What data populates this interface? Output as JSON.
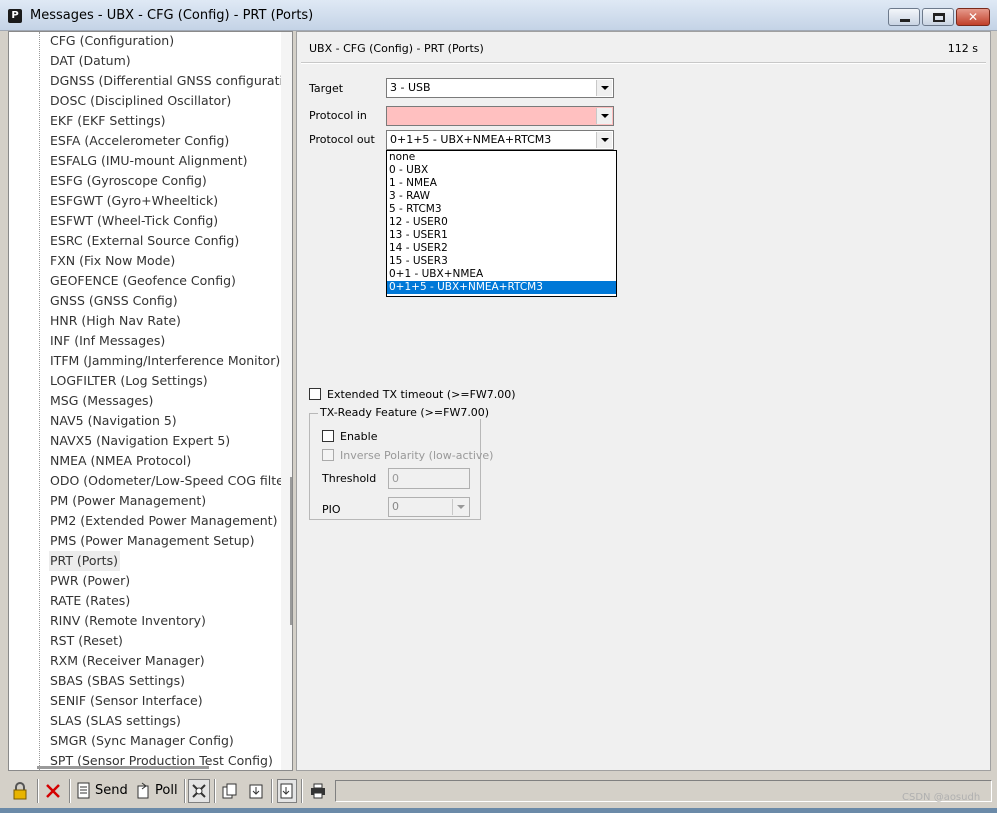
{
  "window": {
    "icon_letter": "P",
    "title": "Messages - UBX - CFG (Config) - PRT (Ports)",
    "close_glyph": "✕"
  },
  "tree": {
    "items": [
      "CFG (Configuration)",
      "DAT (Datum)",
      "DGNSS (Differential GNSS configuration)",
      "DOSC (Disciplined Oscillator)",
      "EKF (EKF Settings)",
      "ESFA (Accelerometer Config)",
      "ESFALG (IMU-mount Alignment)",
      "ESFG (Gyroscope Config)",
      "ESFGWT (Gyro+Wheeltick)",
      "ESFWT (Wheel-Tick Config)",
      "ESRC (External Source Config)",
      "FXN (Fix Now Mode)",
      "GEOFENCE (Geofence Config)",
      "GNSS (GNSS Config)",
      "HNR (High Nav Rate)",
      "INF (Inf Messages)",
      "ITFM (Jamming/Interference Monitor)",
      "LOGFILTER (Log Settings)",
      "MSG (Messages)",
      "NAV5 (Navigation 5)",
      "NAVX5 (Navigation Expert 5)",
      "NMEA (NMEA Protocol)",
      "ODO (Odometer/Low-Speed COG filter)",
      "PM (Power Management)",
      "PM2 (Extended Power Management)",
      "PMS (Power Management Setup)",
      "PRT (Ports)",
      "PWR (Power)",
      "RATE (Rates)",
      "RINV (Remote Inventory)",
      "RST (Reset)",
      "RXM (Receiver Manager)",
      "SBAS (SBAS Settings)",
      "SENIF (Sensor Interface)",
      "SLAS (SLAS settings)",
      "SMGR (Sync Manager Config)",
      "SPT (Sensor Production Test Config)"
    ],
    "selected_index": 26
  },
  "panel": {
    "title": "UBX - CFG (Config) - PRT (Ports)",
    "timer": "112 s",
    "target_label": "Target",
    "target_value": "3 - USB",
    "protocol_in_label": "Protocol in",
    "protocol_in_value": "",
    "protocol_out_label": "Protocol out",
    "protocol_out_value": "0+1+5 - UBX+NMEA+RTCM3",
    "protocol_out_options": [
      "none",
      "0 - UBX",
      "1 - NMEA",
      "3 - RAW",
      "5 - RTCM3",
      "12 - USER0",
      "13 - USER1",
      "14 - USER2",
      "15 - USER3",
      "0+1 - UBX+NMEA",
      "0+1+5 - UBX+NMEA+RTCM3"
    ],
    "protocol_out_selected_index": 10,
    "extended_tx_label": "Extended TX timeout (>=FW7.00)",
    "txready_title": "TX-Ready Feature (>=FW7.00)",
    "enable_label": "Enable",
    "inverse_label": "Inverse Polarity (low-active)",
    "threshold_label": "Threshold",
    "threshold_value": "0",
    "pio_label": "PIO",
    "pio_value": "0",
    "protocol_in_color": "#ffc0c0"
  },
  "toolbar": {
    "send_label": "Send",
    "poll_label": "Poll"
  },
  "watermark": "CSDN @aosudh"
}
